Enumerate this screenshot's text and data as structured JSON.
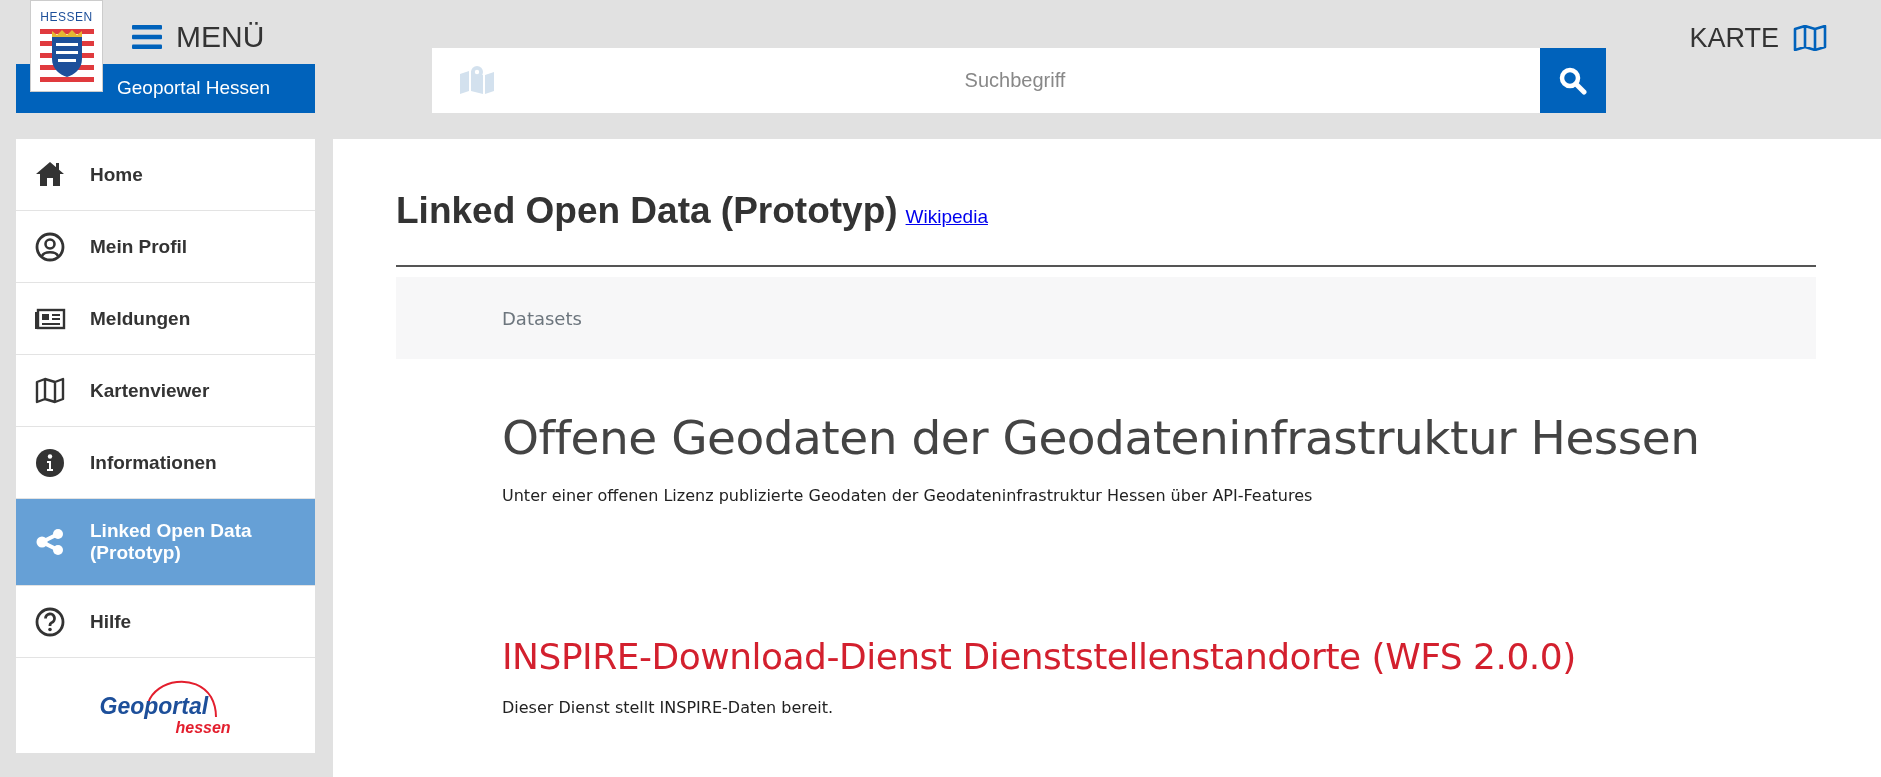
{
  "header": {
    "logo_text": "HESSEN",
    "menu_label": "MENÜ",
    "site_name": "Geoportal Hessen",
    "search": {
      "placeholder": "Suchbegriff"
    },
    "map_link": "KARTE"
  },
  "sidebar": {
    "items": [
      {
        "label": "Home",
        "selected": false
      },
      {
        "label": "Mein Profil",
        "selected": false
      },
      {
        "label": "Meldungen",
        "selected": false
      },
      {
        "label": "Kartenviewer",
        "selected": false
      },
      {
        "label": "Informationen",
        "selected": false
      },
      {
        "label": "Linked Open Data (Prototyp)",
        "selected": true
      },
      {
        "label": "Hilfe",
        "selected": false
      }
    ],
    "footer_logo": {
      "word1": "Geoportal",
      "word2": "hessen"
    }
  },
  "main": {
    "title": "Linked Open Data (Prototyp)",
    "title_link": "Wikipedia",
    "breadcrumb": "Datasets",
    "heading": "Offene Geodaten der Geodateninfrastruktur Hessen",
    "subheading": "Unter einer offenen Lizenz publizierte Geodaten der Geodateninfrastruktur Hessen über API-Features",
    "datasets": [
      {
        "title": "INSPIRE-Download-Dienst Dienststellenstandorte (WFS 2.0.0)",
        "description": "Dieser Dienst stellt INSPIRE-Daten bereit."
      }
    ]
  }
}
